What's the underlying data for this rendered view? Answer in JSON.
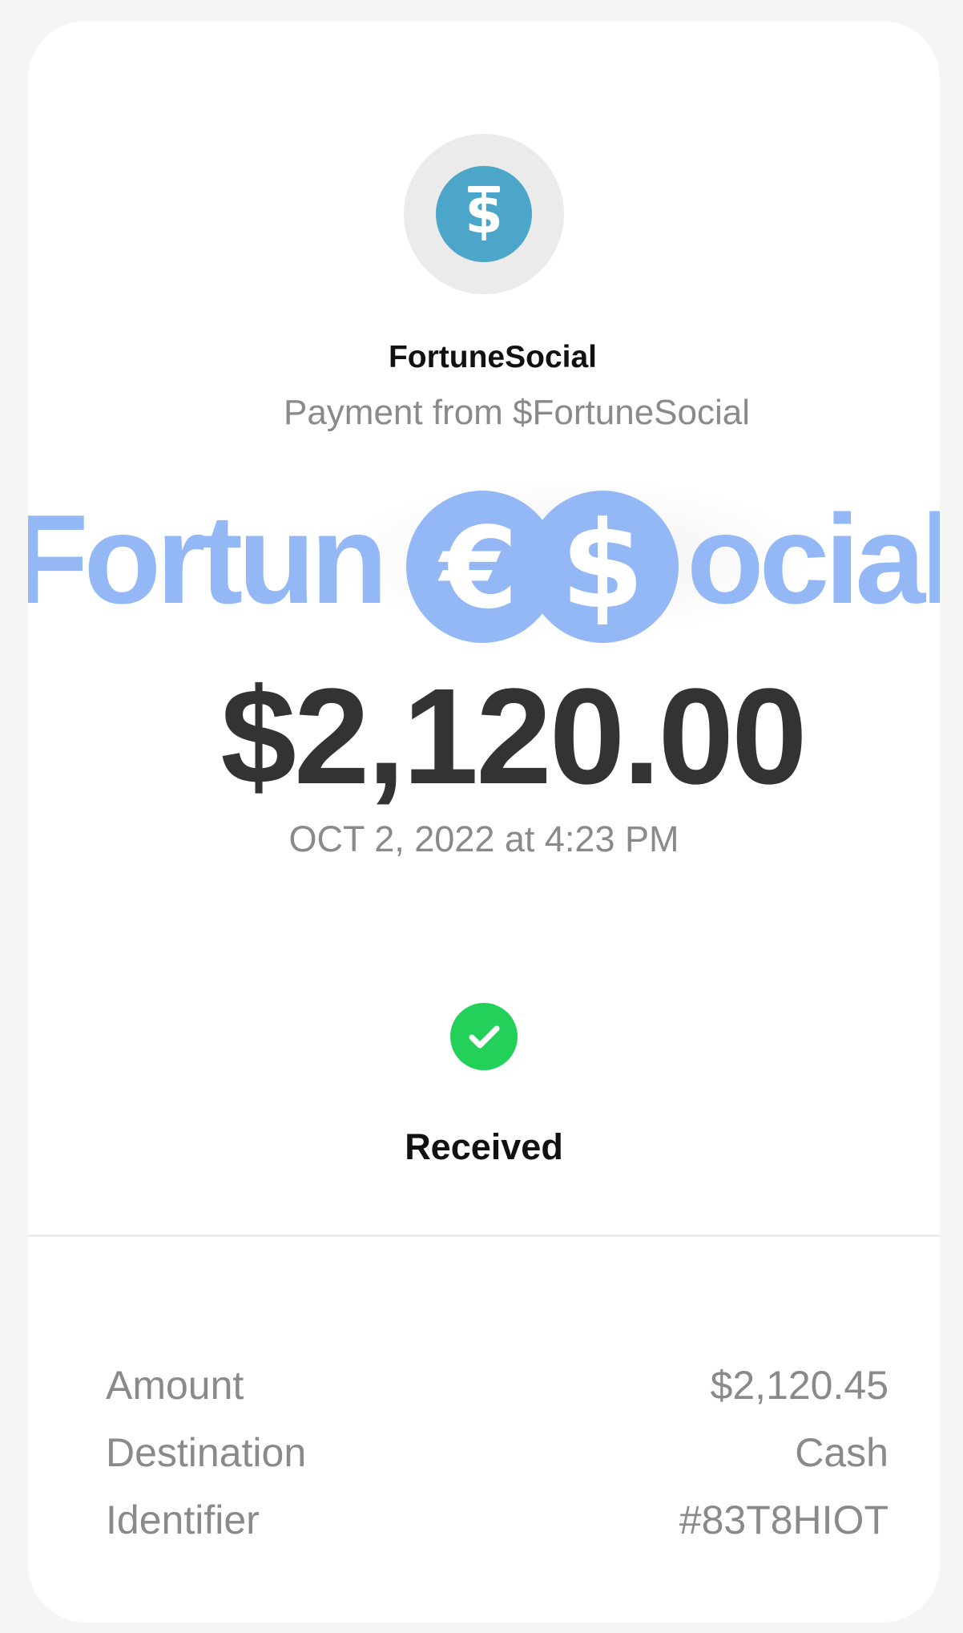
{
  "sender": {
    "avatar_icon": "dollar-coin-icon",
    "avatar_color": "#4ca6c9",
    "name": "FortuneSocial",
    "subtitle": "Payment from $FortuneSocial"
  },
  "watermark": {
    "text_before": "Fortun",
    "coin_1": "€",
    "coin_2": "$",
    "text_after": "ocial",
    "color": "#94b8f5"
  },
  "payment": {
    "amount": "$2,120.00",
    "date": "OCT 2, 2022 at 4:23 PM"
  },
  "status": {
    "icon": "check-circle-icon",
    "color": "#23d05a",
    "label": "Received"
  },
  "details": [
    {
      "label": "Amount",
      "value": "$2,120.45"
    },
    {
      "label": "Destination",
      "value": "Cash"
    },
    {
      "label": "Identifier",
      "value": "#83T8HIOT"
    }
  ]
}
